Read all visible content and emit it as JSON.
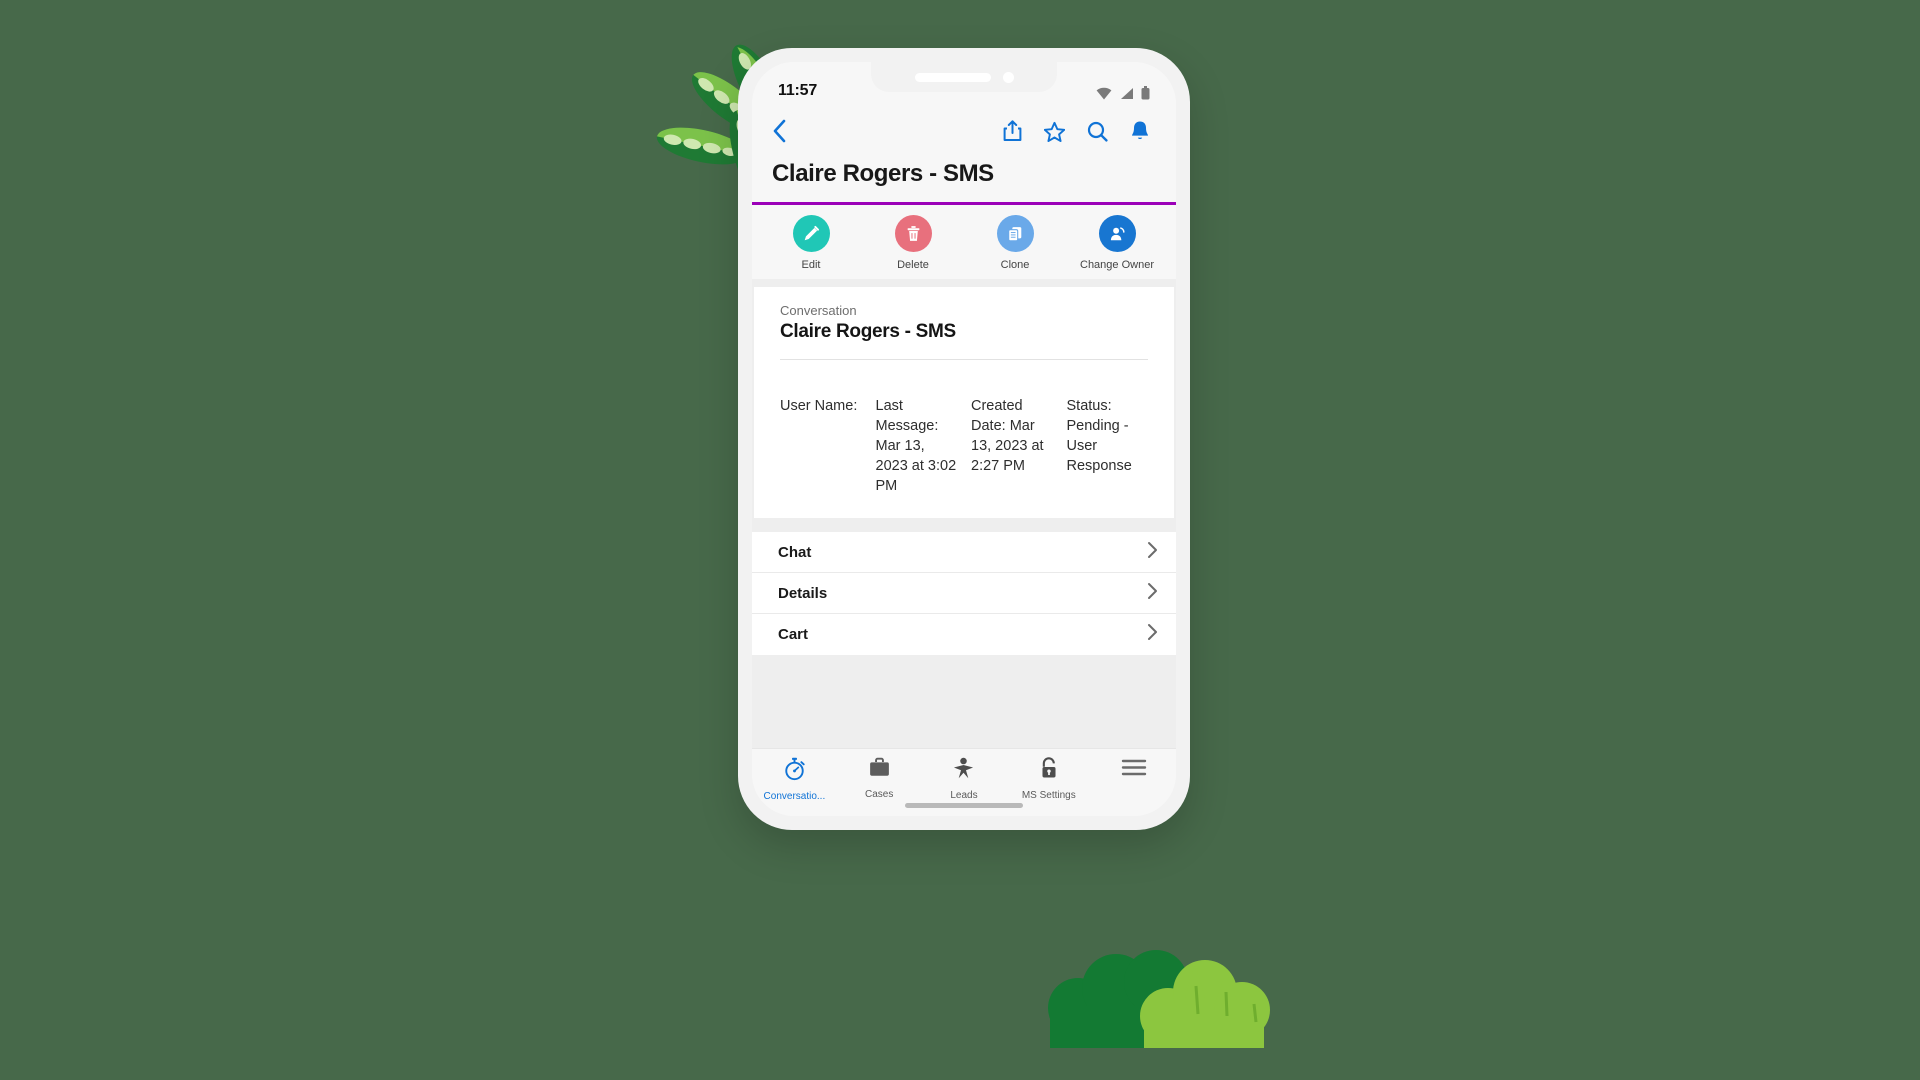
{
  "theme": {
    "background_green": "#47694a",
    "accent_purple": "#9b00b8",
    "link_blue": "#1073d6",
    "edit_teal": "#20c7b6",
    "delete_red": "#e8707d",
    "clone_blue": "#6aa9e9",
    "owner_blue": "#1876d1"
  },
  "status_bar": {
    "time": "11:57",
    "icons": [
      "wifi-icon",
      "cellular-signal-icon",
      "battery-icon"
    ]
  },
  "nav_bar": {
    "back_icon": "chevron-left-icon",
    "actions": [
      {
        "icon": "share-icon",
        "name": "share-button"
      },
      {
        "icon": "star-icon",
        "name": "favorite-button"
      },
      {
        "icon": "search-icon",
        "name": "search-button"
      },
      {
        "icon": "bell-icon",
        "name": "notifications-button"
      }
    ]
  },
  "page": {
    "title": "Claire Rogers - SMS"
  },
  "action_bar": [
    {
      "label": "Edit",
      "icon": "pencil-icon",
      "color": "#20c7b6"
    },
    {
      "label": "Delete",
      "icon": "trash-icon",
      "color": "#e8707d"
    },
    {
      "label": "Clone",
      "icon": "copy-icon",
      "color": "#6aa9e9"
    },
    {
      "label": "Change Owner",
      "icon": "person-swap-icon",
      "color": "#1876d1"
    }
  ],
  "record": {
    "object_label": "Conversation",
    "name": "Claire Rogers - SMS",
    "fields": [
      {
        "label": "User Name:",
        "value": ""
      },
      {
        "label": "Last Message:",
        "value": "Mar 13, 2023 at 3:02 PM"
      },
      {
        "label": "Created Date:",
        "value": "Mar 13, 2023 at 2:27 PM"
      },
      {
        "label": "Status:",
        "value": "Pending - User Response"
      }
    ]
  },
  "related_rows": [
    {
      "label": "Chat",
      "chevron": "chevron-right-icon"
    },
    {
      "label": "Details",
      "chevron": "chevron-right-icon"
    },
    {
      "label": "Cart",
      "chevron": "chevron-right-icon"
    }
  ],
  "tab_bar": [
    {
      "label": "Conversatio...",
      "icon": "stopwatch-icon",
      "active": true
    },
    {
      "label": "Cases",
      "icon": "briefcase-icon",
      "active": false
    },
    {
      "label": "Leads",
      "icon": "person-star-icon",
      "active": false
    },
    {
      "label": "MS Settings",
      "icon": "unlocked-padlock-icon",
      "active": false
    },
    {
      "label": "",
      "icon": "hamburger-menu-icon",
      "active": false
    }
  ]
}
